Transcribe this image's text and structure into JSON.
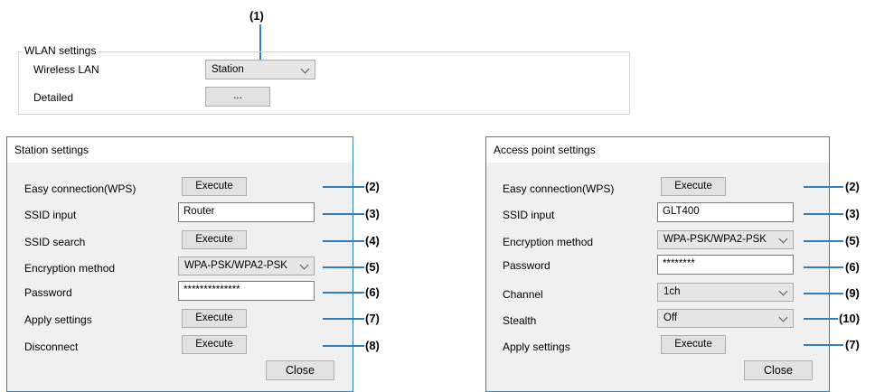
{
  "wlan": {
    "group_title": "WLAN settings",
    "wireless_lan_label": "Wireless LAN",
    "wireless_lan_value": "Station",
    "detailed_label": "Detailed",
    "detailed_button": "...",
    "callout": "(1)"
  },
  "station": {
    "title": "Station settings",
    "rows": [
      {
        "label": "Easy connection(WPS)",
        "control": "Execute",
        "callout": "(2)"
      },
      {
        "label": "SSID input",
        "control": "Router",
        "callout": "(3)"
      },
      {
        "label": "SSID search",
        "control": "Execute",
        "callout": "(4)"
      },
      {
        "label": "Encryption method",
        "control": "WPA-PSK/WPA2-PSK",
        "callout": "(5)"
      },
      {
        "label": "Password",
        "control": "**************",
        "callout": "(6)"
      },
      {
        "label": "Apply settings",
        "control": "Execute",
        "callout": "(7)"
      },
      {
        "label": "Disconnect",
        "control": "Execute",
        "callout": "(8)"
      }
    ],
    "close_button": "Close"
  },
  "access_point": {
    "title": "Access point settings",
    "rows": [
      {
        "label": "Easy connection(WPS)",
        "control": "Execute",
        "callout": "(2)"
      },
      {
        "label": "SSID input",
        "control": "GLT400",
        "callout": "(3)"
      },
      {
        "label": "Encryption method",
        "control": "WPA-PSK/WPA2-PSK",
        "callout": "(5)"
      },
      {
        "label": "Password",
        "control": "********",
        "callout": "(6)"
      },
      {
        "label": "Channel",
        "control": "1ch",
        "callout": "(9)"
      },
      {
        "label": "Stealth",
        "control": "Off",
        "callout": "(10)"
      },
      {
        "label": "Apply settings",
        "control": "Execute",
        "callout": "(7)"
      }
    ],
    "close_button": "Close"
  },
  "colors": {
    "callout_line": "#2e7fc0",
    "dialog_border": "#3c7fb1",
    "dialog_body": "#f0f0f0"
  }
}
